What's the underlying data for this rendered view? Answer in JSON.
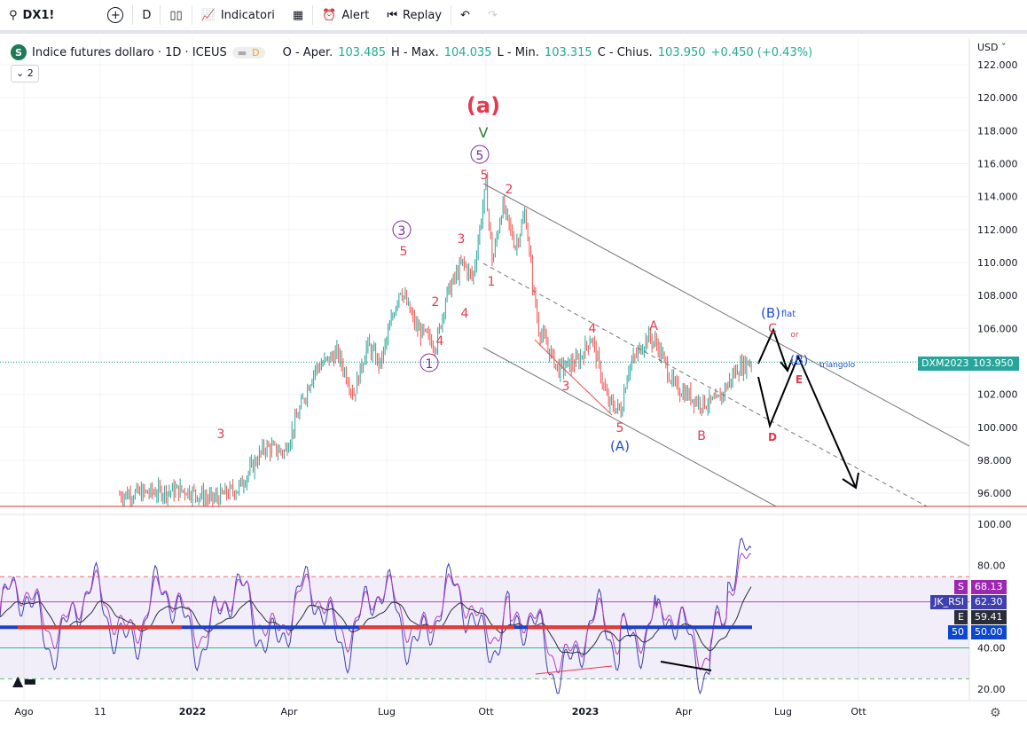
{
  "toolbar": {
    "symbol": "DX1!",
    "interval": "D",
    "indicators": "Indicatori",
    "alert": "Alert",
    "replay": "Replay"
  },
  "legend": {
    "title": "Indice futures dollaro · 1D · ICEUS",
    "logo": "S",
    "badge": "D",
    "o_label": "O - Aper.",
    "o": "103.485",
    "h_label": "H - Max.",
    "h": "104.035",
    "l_label": "L - Min.",
    "l": "103.315",
    "c_label": "C - Chius.",
    "c": "103.950",
    "change": "+0.450 (+0.43%)",
    "collapse": "2"
  },
  "price_axis": {
    "currency": "USD",
    "ticks": [
      "122.000",
      "120.000",
      "118.000",
      "116.000",
      "114.000",
      "112.000",
      "110.000",
      "108.000",
      "106.000",
      "104.000",
      "102.000",
      "100.000",
      "98.000",
      "96.000"
    ],
    "last_symbol": "DXM2023",
    "last_price": "103.950"
  },
  "rsi_axis": {
    "ticks": [
      "100.00",
      "80.00",
      "40.00",
      "20.00"
    ],
    "tags": [
      {
        "label": "S",
        "value": "68.13",
        "color": "#9c27b0"
      },
      {
        "label": "JK_RSI",
        "value": "62.30",
        "color": "#3f3fb0"
      },
      {
        "label": "E",
        "value": "59.41",
        "color": "#2a2e39"
      },
      {
        "label": "50",
        "value": "50.00",
        "color": "#0d47d0"
      }
    ]
  },
  "time_axis": [
    "Ago",
    "11",
    "2022",
    "Apr",
    "Lug",
    "Ott",
    "2023",
    "Apr",
    "Lug",
    "Ott"
  ],
  "annotations": [
    "(a)",
    "V",
    "5",
    "5",
    "2",
    "3",
    "5",
    "3",
    "1",
    "4",
    "2",
    "4",
    "1",
    "3",
    "4",
    "3",
    "5",
    "(A)",
    "A",
    "B",
    "(B)",
    "flat",
    "C",
    "or",
    "(B)",
    "triangolo",
    "E",
    "D",
    "3"
  ],
  "colors": {
    "up": "#26a69a",
    "down": "#ef5350",
    "wave": "#e53950",
    "purple": "#7b2a9c",
    "blue": "#1e4fd8"
  },
  "price_series": [
    [
      2.9,
      95.9
    ],
    [
      4.9,
      96.2
    ],
    [
      5.7,
      95.6
    ],
    [
      6.5,
      96.3
    ],
    [
      7.3,
      98.8
    ],
    [
      7.9,
      98.5
    ],
    [
      8.8,
      103.5
    ],
    [
      9.5,
      104.5
    ],
    [
      10.0,
      102
    ],
    [
      10.4,
      105
    ],
    [
      10.8,
      103.8
    ],
    [
      11.4,
      108.5
    ],
    [
      11.9,
      106
    ],
    [
      12.5,
      105
    ],
    [
      12.8,
      108
    ],
    [
      13.3,
      110
    ],
    [
      13.6,
      109
    ],
    [
      14.0,
      114.7
    ],
    [
      14.2,
      110
    ],
    [
      14.5,
      113.5
    ],
    [
      14.9,
      111
    ],
    [
      15.2,
      113
    ],
    [
      15.4,
      109
    ],
    [
      15.6,
      106
    ],
    [
      16.2,
      103.5
    ],
    [
      16.8,
      104
    ],
    [
      17.2,
      105.5
    ],
    [
      17.7,
      101.5
    ],
    [
      18.1,
      101
    ],
    [
      18.3,
      103.5
    ],
    [
      18.9,
      105.5
    ],
    [
      19.2,
      105
    ],
    [
      19.7,
      102.5
    ],
    [
      20.5,
      101.5
    ],
    [
      21.0,
      101.5
    ],
    [
      21.6,
      103.5
    ],
    [
      22.0,
      104
    ]
  ]
}
